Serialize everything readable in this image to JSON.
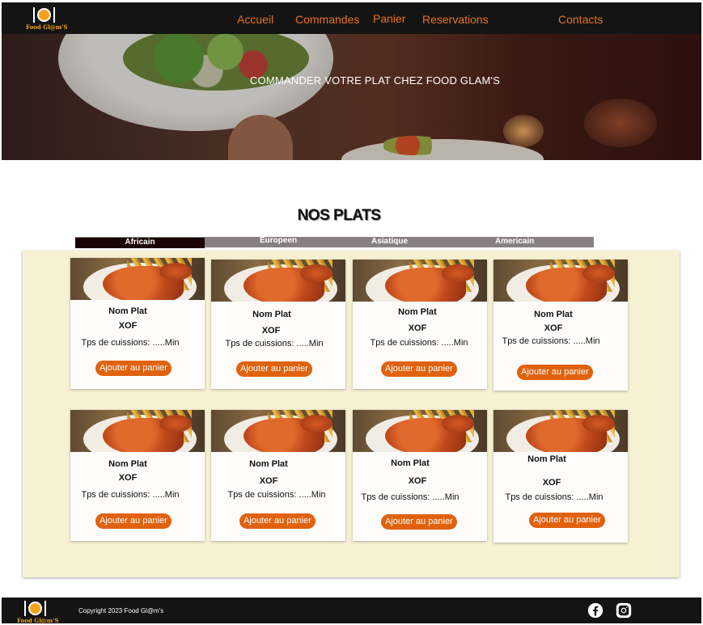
{
  "brand": {
    "name": "Food Gl@m'S"
  },
  "nav": {
    "links": [
      "Accueil",
      "Commandes",
      "Panier",
      "Reservations",
      "Contacts"
    ]
  },
  "hero": {
    "title": "COMMANDER VOTRE PLAT CHEZ FOOD GLAM'S"
  },
  "menu": {
    "section_title": "NOS PLATS",
    "tabs": [
      {
        "label": "Africain",
        "active": true
      },
      {
        "label": "Europeen",
        "active": false
      },
      {
        "label": "Asiatique",
        "active": false
      },
      {
        "label": "Americain",
        "active": false
      }
    ],
    "cards": [
      {
        "name": "Nom Plat",
        "price": "XOF",
        "time": "Tps de cuissions: .....Min",
        "button": "Ajouter au panier"
      },
      {
        "name": "Nom Plat",
        "price": "XOF",
        "time": "Tps de cuissions: .....Min",
        "button": "Ajouter au panier"
      },
      {
        "name": "Nom Plat",
        "price": "XOF",
        "time": "Tps de cuissions: .....Min",
        "button": "Ajouter au panier"
      },
      {
        "name": "Nom Plat",
        "price": "XOF",
        "time": "Tps de cuissions: .....Min",
        "button": "Ajouter au panier"
      },
      {
        "name": "Nom Plat",
        "price": "XOF",
        "time": "Tps de cuissions: .....Min",
        "button": "Ajouter au panier"
      },
      {
        "name": "Nom Plat",
        "price": "XOF",
        "time": "Tps de cuissions: .....Min",
        "button": "Ajouter au panier"
      },
      {
        "name": "Nom Plat",
        "price": "XOF",
        "time": "Tps de cuissions: .....Min",
        "button": "Ajouter au panier"
      },
      {
        "name": "Nom Plat",
        "price": "XOF",
        "time": "Tps de cuissions: .....Min",
        "button": "Ajouter au panier"
      }
    ]
  },
  "footer": {
    "copyright": "Copyright 2023  Food Gl@m's",
    "social_icons": [
      "facebook-icon",
      "instagram-icon"
    ]
  },
  "colors": {
    "accent": "#e0620f",
    "nav_text": "#e8731c",
    "bar": "#141414",
    "panel": "#f6f1d3",
    "tab_active": "#1a0304",
    "tab_bar": "#897f82"
  }
}
